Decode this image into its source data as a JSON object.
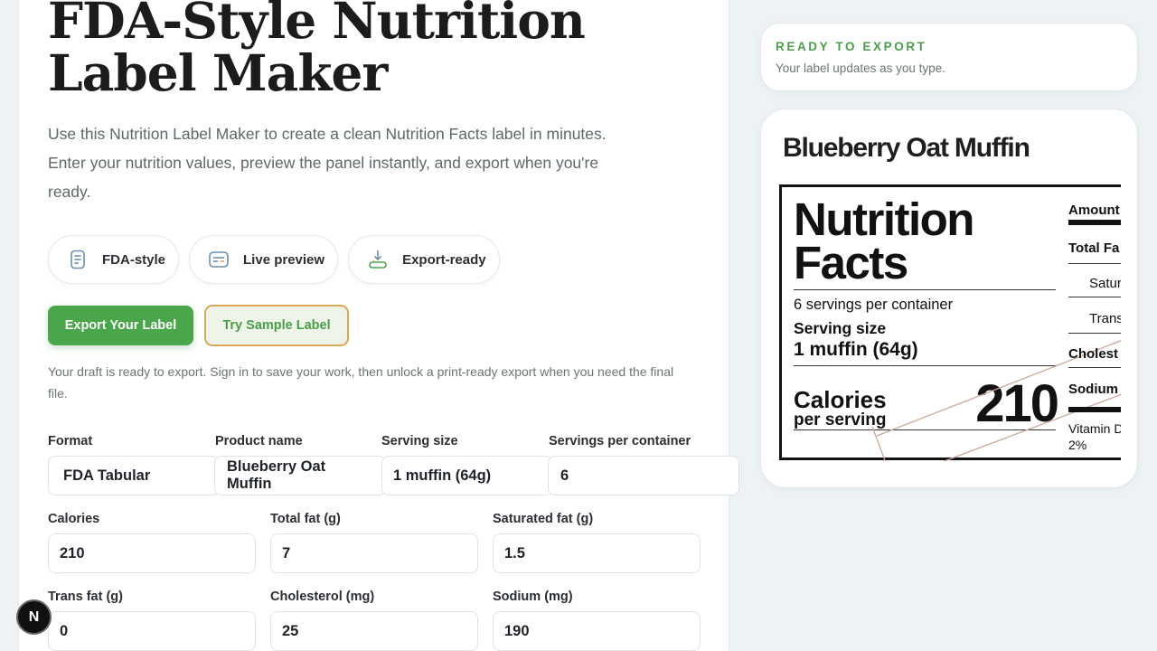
{
  "header": {
    "title": "FDA-Style Nutrition Label Maker",
    "intro": "Use this Nutrition Label Maker to create a clean Nutrition Facts label in minutes. Enter your nutrition values, preview the panel instantly, and export when you're ready."
  },
  "features": [
    {
      "label": "FDA-style",
      "icon": "document-icon"
    },
    {
      "label": "Live preview",
      "icon": "preview-card-icon"
    },
    {
      "label": "Export-ready",
      "icon": "download-tray-icon"
    }
  ],
  "actions": {
    "export_label": "Export Your Label",
    "sample_label": "Try Sample Label",
    "draft_note": "Your draft is ready to export. Sign in to save your work, then unlock a print-ready export when you need the final file."
  },
  "form": {
    "format": {
      "label": "Format",
      "value": "FDA Tabular"
    },
    "product_name": {
      "label": "Product name",
      "value": "Blueberry Oat Muffin"
    },
    "serving_size": {
      "label": "Serving size",
      "value": "1 muffin (64g)"
    },
    "servings_per_container": {
      "label": "Servings per container",
      "value": "6"
    },
    "calories": {
      "label": "Calories",
      "value": "210"
    },
    "total_fat": {
      "label": "Total fat (g)",
      "value": "7"
    },
    "saturated_fat": {
      "label": "Saturated fat (g)",
      "value": "1.5"
    },
    "trans_fat": {
      "label": "Trans fat (g)",
      "value": "0"
    },
    "cholesterol": {
      "label": "Cholesterol (mg)",
      "value": "25"
    },
    "sodium": {
      "label": "Sodium (mg)",
      "value": "190"
    }
  },
  "status": {
    "title": "READY TO EXPORT",
    "subtitle": "Your label updates as you type."
  },
  "preview": {
    "product_name": "Blueberry Oat Muffin",
    "heading": "Nutrition Facts",
    "servings": "6 servings per container",
    "serving_size_label": "Serving size",
    "serving_size_value": "1 muffin (64g)",
    "calories_label": "Calories",
    "calories_sub": "per serving",
    "calories_value": "210",
    "col2": {
      "amount": "Amount",
      "total_fat": "Total Fa",
      "saturated": "Satur",
      "trans": "Trans",
      "cholesterol": "Cholest",
      "sodium": "Sodium",
      "vitamin_d": "Vitamin D",
      "vitamin_d_pct": "2%"
    }
  },
  "badge": {
    "letter": "N"
  },
  "colors": {
    "accent_green": "#4aa64a",
    "secondary_border": "#dba858",
    "background": "#edf2f5"
  }
}
